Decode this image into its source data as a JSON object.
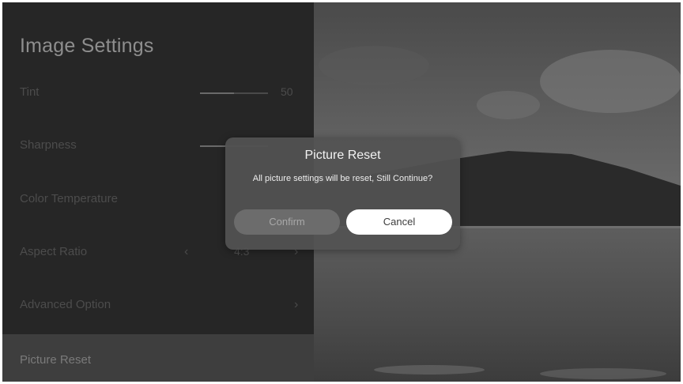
{
  "panel": {
    "title": "Image Settings",
    "items": [
      {
        "label": "Tint",
        "value": "50",
        "slider_level": 0.5
      },
      {
        "label": "Sharpness",
        "slider_level": 0.4
      },
      {
        "label": "Color Temperature"
      },
      {
        "label": "Aspect Ratio",
        "value": "4:3",
        "prev_icon": "chevron-left-icon",
        "next_icon": "chevron-right-icon"
      },
      {
        "label": "Advanced Option",
        "next_icon": "chevron-right-icon"
      },
      {
        "label": "Picture Reset",
        "selected": true
      }
    ]
  },
  "dialog": {
    "title": "Picture Reset",
    "message": "All picture settings will be reset, Still Continue?",
    "confirm_label": "Confirm",
    "cancel_label": "Cancel",
    "focused": "cancel"
  },
  "colors": {
    "panel_bg": "#262626",
    "dialog_bg": "#525252",
    "focused_button": "#ffffff"
  }
}
